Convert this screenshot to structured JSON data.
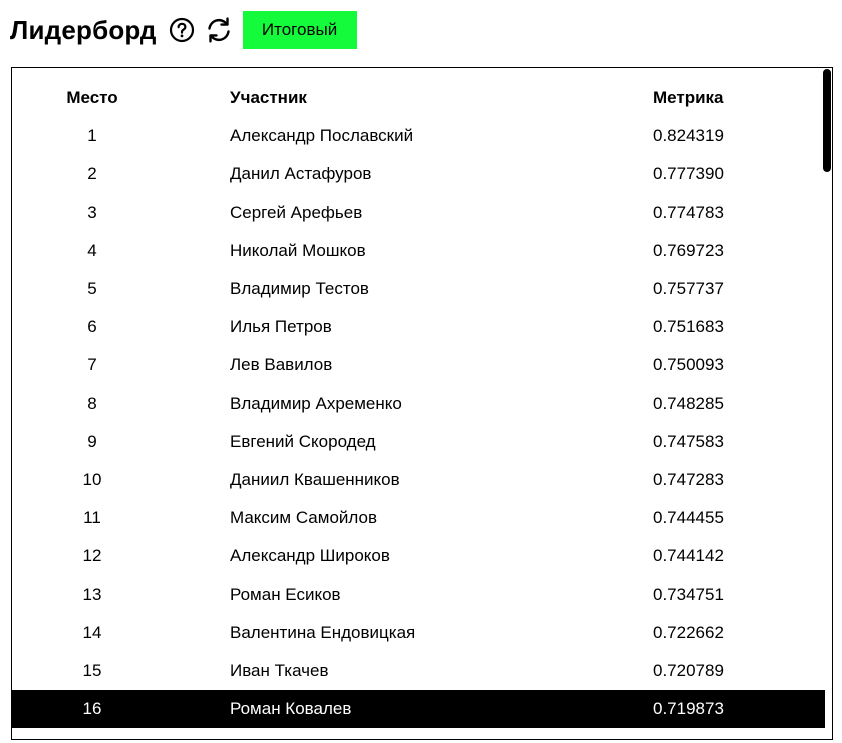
{
  "header": {
    "title": "Лидерборд",
    "final_button_label": "Итоговый"
  },
  "table": {
    "columns": [
      "Место",
      "Участник",
      "Метрика"
    ],
    "rows": [
      {
        "place": "1",
        "name": "Александр Пославский",
        "metric": "0.824319"
      },
      {
        "place": "2",
        "name": "Данил Астафуров",
        "metric": "0.777390"
      },
      {
        "place": "3",
        "name": "Сергей Арефьев",
        "metric": "0.774783"
      },
      {
        "place": "4",
        "name": "Николай Мошков",
        "metric": "0.769723"
      },
      {
        "place": "5",
        "name": "Владимир Тестов",
        "metric": "0.757737"
      },
      {
        "place": "6",
        "name": "Илья Петров",
        "metric": "0.751683"
      },
      {
        "place": "7",
        "name": "Лев Вавилов",
        "metric": "0.750093"
      },
      {
        "place": "8",
        "name": "Владимир Ахременко",
        "metric": "0.748285"
      },
      {
        "place": "9",
        "name": "Евгений Скороде­д",
        "metric": "0.747583"
      },
      {
        "place": "10",
        "name": "Даниил Квашенников",
        "metric": "0.747283"
      },
      {
        "place": "11",
        "name": "Максим Самойлов",
        "metric": "0.744455"
      },
      {
        "place": "12",
        "name": "Александр Широков",
        "metric": "0.744142"
      },
      {
        "place": "13",
        "name": "Роман Есиков",
        "metric": "0.734751"
      },
      {
        "place": "14",
        "name": "Валентина Ендовицкая",
        "metric": "0.722662"
      },
      {
        "place": "15",
        "name": "Иван Ткачев",
        "metric": "0.720789"
      },
      {
        "place": "16",
        "name": "Роман Ковалев",
        "metric": "0.719873",
        "selected": true
      }
    ]
  },
  "icons": {
    "help": "help-circle-icon",
    "refresh": "refresh-icon"
  },
  "colors": {
    "accent_button": "#14fb3c",
    "selected_row_bg": "#000000",
    "selected_row_text": "#ffffff"
  }
}
